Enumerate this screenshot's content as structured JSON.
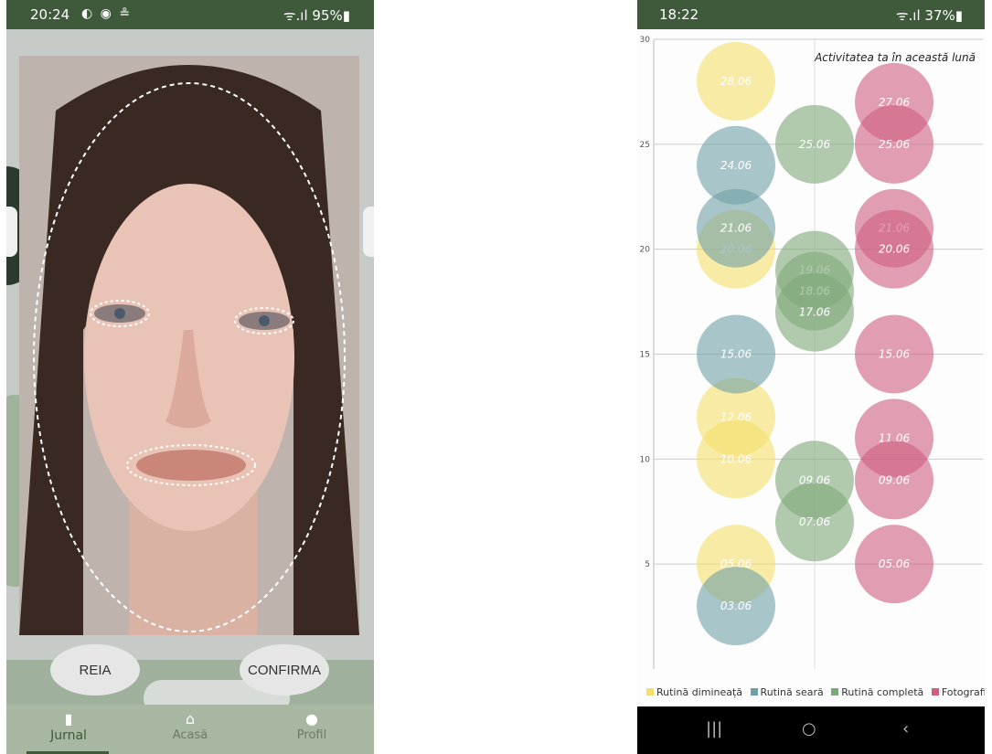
{
  "left_phone": {
    "status_time": "20:24",
    "status_right": "ᯤ.ıl 95%▮",
    "buttons": {
      "retake": "REIA",
      "confirm": "CONFIRMA"
    },
    "nav": {
      "journal": "Jurnal",
      "home": "Acasă",
      "profile": "Profil"
    },
    "icons": [
      "notebook-icon",
      "home-icon",
      "person-icon"
    ]
  },
  "right_phone": {
    "status_time": "18:22",
    "status_right": "ᯤ.ıl 37%▮",
    "system_nav": {
      "recent": "|||",
      "home": "○",
      "back": "‹"
    }
  },
  "colors": {
    "morning": "#f4e06a",
    "evening": "#6fa0a6",
    "complete": "#7ea87a",
    "photo": "#cf5f80",
    "brand_green": "#3e5a3b"
  },
  "chart_data": {
    "type": "scatter",
    "title": "Activitatea ta în această lună",
    "ylim": [
      0,
      30
    ],
    "yticks": [
      5,
      10,
      15,
      20,
      25,
      30
    ],
    "grid": true,
    "legend_position": "bottom",
    "categories": [
      "Rutină dimineață",
      "Rutină seară",
      "Rutină completă",
      "Fotografie facială"
    ],
    "series": [
      {
        "name": "Rutină dimineață",
        "x": 0,
        "points": [
          {
            "y": 28,
            "label": "28.06"
          },
          {
            "y": 20,
            "label": "20.06"
          },
          {
            "y": 12,
            "label": "12.06"
          },
          {
            "y": 10,
            "label": "10.06"
          },
          {
            "y": 5,
            "label": "05.06"
          }
        ]
      },
      {
        "name": "Rutină seară",
        "x": 0,
        "points": [
          {
            "y": 24,
            "label": "24.06"
          },
          {
            "y": 21,
            "label": "21.06"
          },
          {
            "y": 15,
            "label": "15.06"
          },
          {
            "y": 3,
            "label": "03.06"
          }
        ]
      },
      {
        "name": "Rutină completă",
        "x": 1,
        "points": [
          {
            "y": 25,
            "label": "25.06"
          },
          {
            "y": 19,
            "label": "19.06"
          },
          {
            "y": 18,
            "label": "18.06"
          },
          {
            "y": 17,
            "label": "17.06"
          },
          {
            "y": 9,
            "label": "09.06"
          },
          {
            "y": 7,
            "label": "07.06"
          }
        ]
      },
      {
        "name": "Fotografie facială",
        "x": 2,
        "points": [
          {
            "y": 27,
            "label": "27.06"
          },
          {
            "y": 25,
            "label": "25.06"
          },
          {
            "y": 21,
            "label": "21.06"
          },
          {
            "y": 20,
            "label": "20.06"
          },
          {
            "y": 15,
            "label": "15.06"
          },
          {
            "y": 11,
            "label": "11.06"
          },
          {
            "y": 9,
            "label": "09.06"
          },
          {
            "y": 5,
            "label": "05.06"
          }
        ]
      }
    ]
  }
}
